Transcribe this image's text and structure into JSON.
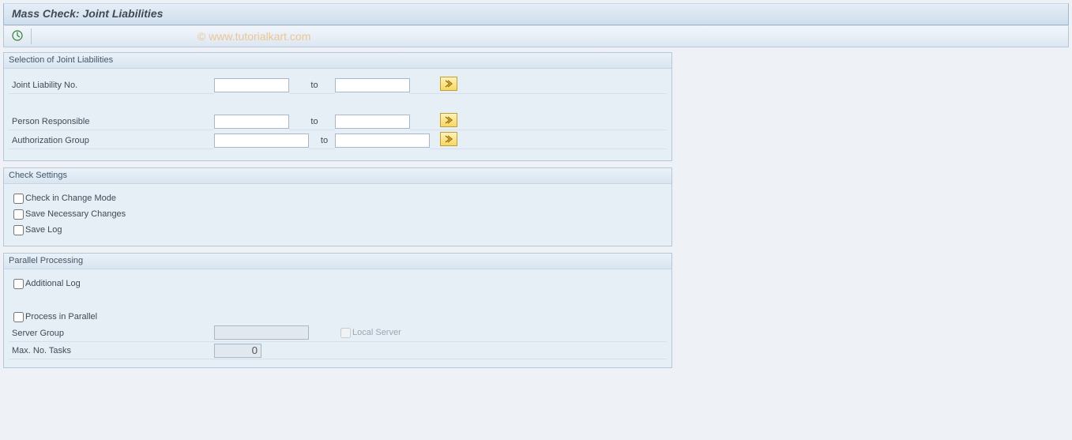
{
  "header": {
    "title": "Mass Check: Joint Liabilities"
  },
  "watermark": "© www.tutorialkart.com",
  "groups": {
    "selection": {
      "title": "Selection of Joint Liabilities",
      "rows": {
        "jlno": {
          "label": "Joint Liability No.",
          "to": "to",
          "from": "",
          "toval": ""
        },
        "person": {
          "label": "Person Responsible",
          "to": "to",
          "from": "",
          "toval": ""
        },
        "authg": {
          "label": "Authorization Group",
          "to": "to",
          "from": "",
          "toval": ""
        }
      }
    },
    "check": {
      "title": "Check Settings",
      "opts": {
        "change": "Check in Change Mode",
        "save": "Save Necessary Changes",
        "log": "Save Log"
      }
    },
    "parallel": {
      "title": "Parallel Processing",
      "opts": {
        "addlog": "Additional Log",
        "parallel": "Process in Parallel",
        "server_label": "Server Group",
        "server_value": "",
        "local": "Local Server",
        "max_label": "Max. No. Tasks",
        "max_value": "0"
      }
    }
  }
}
